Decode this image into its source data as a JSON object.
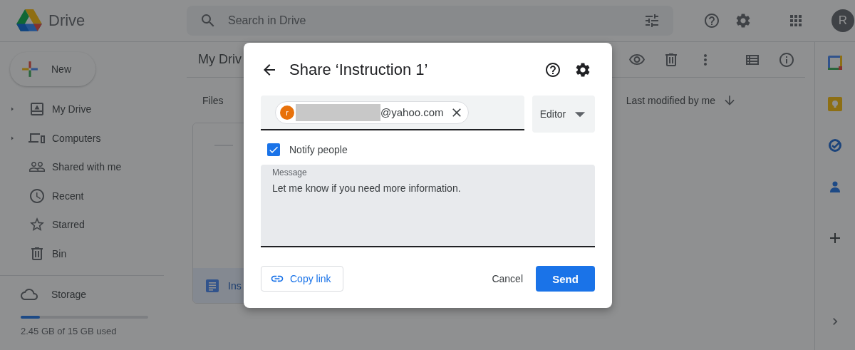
{
  "header": {
    "product": "Drive",
    "search": {
      "placeholder": "Search in Drive"
    },
    "avatar": "R"
  },
  "sidebar": {
    "new_button": "New",
    "items": [
      {
        "label": "My Drive",
        "collapsible": true
      },
      {
        "label": "Computers",
        "collapsible": true
      },
      {
        "label": "Shared with me",
        "collapsible": false
      },
      {
        "label": "Recent",
        "collapsible": false
      },
      {
        "label": "Starred",
        "collapsible": false
      },
      {
        "label": "Bin",
        "collapsible": false
      }
    ],
    "storage": {
      "label": "Storage",
      "level": 0.15,
      "usage": "2.45 GB of 15 GB used"
    }
  },
  "main": {
    "title": "My Driv",
    "section": "Files",
    "sort": "Last modified by me",
    "files": [
      {
        "name": "Ins"
      }
    ]
  },
  "dialog": {
    "title": "Share ‘Instruction 1’",
    "recipient": {
      "initial": "r",
      "email": "@yahoo.com"
    },
    "role": "Editor",
    "notify": {
      "label": "Notify people",
      "checked": true
    },
    "message": {
      "label": "Message",
      "value": "Let me know if you need more information."
    },
    "copy_link": "Copy link",
    "cancel": "Cancel",
    "send": "Send"
  }
}
